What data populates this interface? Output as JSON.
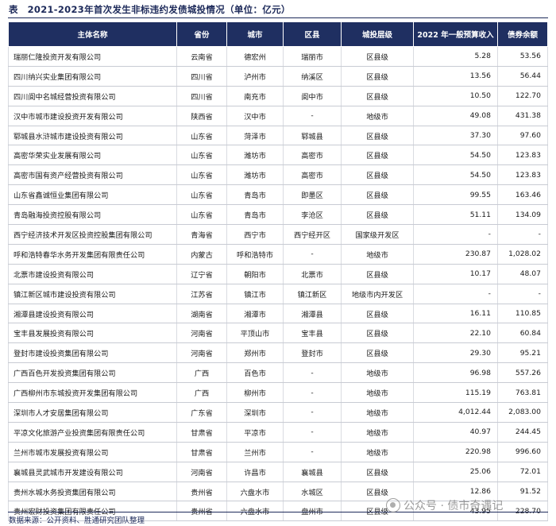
{
  "title": "表　2021-2023年首次发生非标违约发债城投情况（单位：亿元）",
  "columns": [
    "主体名称",
    "省份",
    "城市",
    "区县",
    "城投层级",
    "2022 年一般预算收入",
    "债券余额"
  ],
  "rows": [
    [
      "瑞丽仁隆投资开发有限公司",
      "云南省",
      "德宏州",
      "瑞丽市",
      "区县级",
      "5.28",
      "53.56"
    ],
    [
      "四川纳兴实业集团有限公司",
      "四川省",
      "泸州市",
      "纳溪区",
      "区县级",
      "13.56",
      "56.44"
    ],
    [
      "四川阆中名城经营投资有限公司",
      "四川省",
      "南充市",
      "阆中市",
      "区县级",
      "10.50",
      "122.70"
    ],
    [
      "汉中市城市建设投资开发有限公司",
      "陕西省",
      "汉中市",
      "-",
      "地级市",
      "49.08",
      "431.38"
    ],
    [
      "郓城县水浒城市建设投资有限公司",
      "山东省",
      "菏泽市",
      "郓城县",
      "区县级",
      "37.30",
      "97.60"
    ],
    [
      "高密华荣实业发展有限公司",
      "山东省",
      "潍坊市",
      "高密市",
      "区县级",
      "54.50",
      "123.83"
    ],
    [
      "高密市国有资产经营投资有限公司",
      "山东省",
      "潍坊市",
      "高密市",
      "区县级",
      "54.50",
      "123.83"
    ],
    [
      "山东省鑫诚恒业集团有限公司",
      "山东省",
      "青岛市",
      "即墨区",
      "区县级",
      "99.55",
      "163.46"
    ],
    [
      "青岛融海投资控股有限公司",
      "山东省",
      "青岛市",
      "李沧区",
      "区县级",
      "51.11",
      "134.09"
    ],
    [
      "西宁经济技术开发区投资控股集团有限公司",
      "青海省",
      "西宁市",
      "西宁经开区",
      "国家级开发区",
      "-",
      "-"
    ],
    [
      "呼和浩特春华水务开发集团有限责任公司",
      "内蒙古",
      "呼和浩特市",
      "-",
      "地级市",
      "230.87",
      "1,028.02"
    ],
    [
      "北票市建设投资有限公司",
      "辽宁省",
      "朝阳市",
      "北票市",
      "区县级",
      "10.17",
      "48.07"
    ],
    [
      "镇江新区城市建设投资有限公司",
      "江苏省",
      "镇江市",
      "镇江新区",
      "地级市内开发区",
      "-",
      "-"
    ],
    [
      "湘潭县建设投资有限公司",
      "湖南省",
      "湘潭市",
      "湘潭县",
      "区县级",
      "16.11",
      "110.85"
    ],
    [
      "宝丰县发展投资有限公司",
      "河南省",
      "平顶山市",
      "宝丰县",
      "区县级",
      "22.10",
      "60.84"
    ],
    [
      "登封市建设投资集团有限公司",
      "河南省",
      "郑州市",
      "登封市",
      "区县级",
      "29.30",
      "95.21"
    ],
    [
      "广西百色开发投资集团有限公司",
      "广西",
      "百色市",
      "-",
      "地级市",
      "96.98",
      "557.26"
    ],
    [
      "广西柳州市东城投资开发集团有限公司",
      "广西",
      "柳州市",
      "-",
      "地级市",
      "115.19",
      "763.81"
    ],
    [
      "深圳市人才安居集团有限公司",
      "广东省",
      "深圳市",
      "-",
      "地级市",
      "4,012.44",
      "2,083.00"
    ],
    [
      "平凉文化旅游产业投资集团有限责任公司",
      "甘肃省",
      "平凉市",
      "-",
      "地级市",
      "40.97",
      "244.45"
    ],
    [
      "兰州市城市发展投资有限公司",
      "甘肃省",
      "兰州市",
      "-",
      "地级市",
      "220.98",
      "996.60"
    ],
    [
      "襄城县灵武城市开发建设有限公司",
      "河南省",
      "许昌市",
      "襄城县",
      "区县级",
      "25.06",
      "72.01"
    ],
    [
      "贵州水城水务投资集团有限公司",
      "贵州省",
      "六盘水市",
      "水城区",
      "区县级",
      "12.86",
      "91.52"
    ],
    [
      "贵州宏财投资集团有限责任公司",
      "贵州省",
      "六盘水市",
      "盘州市",
      "区县级",
      "43.95",
      "228.70"
    ]
  ],
  "footer": "数据来源：公开资料、胜通研究团队整理",
  "watermark": {
    "text": "公众号 · 债市奇遇记",
    "icon": "wechat-icon"
  }
}
